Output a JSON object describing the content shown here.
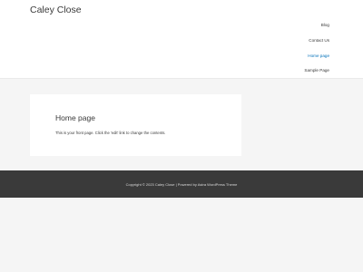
{
  "header": {
    "site_title": "Caley Close",
    "nav": [
      {
        "label": "Blog",
        "active": false
      },
      {
        "label": "Contact Us",
        "active": false
      },
      {
        "label": "Home page",
        "active": true
      },
      {
        "label": "Sample Page",
        "active": false
      }
    ]
  },
  "main": {
    "page_title": "Home page",
    "body_text": "This is your front page. Click the 'edit' link to change the contents."
  },
  "footer": {
    "text": "Copyright © 2023 Caley Close | Powered by Astra WordPress Theme"
  },
  "colors": {
    "background": "#f5f5f5",
    "surface": "#ffffff",
    "text": "#3a3a3a",
    "accent": "#0170b9",
    "footer_bg": "#3a3a3a"
  }
}
